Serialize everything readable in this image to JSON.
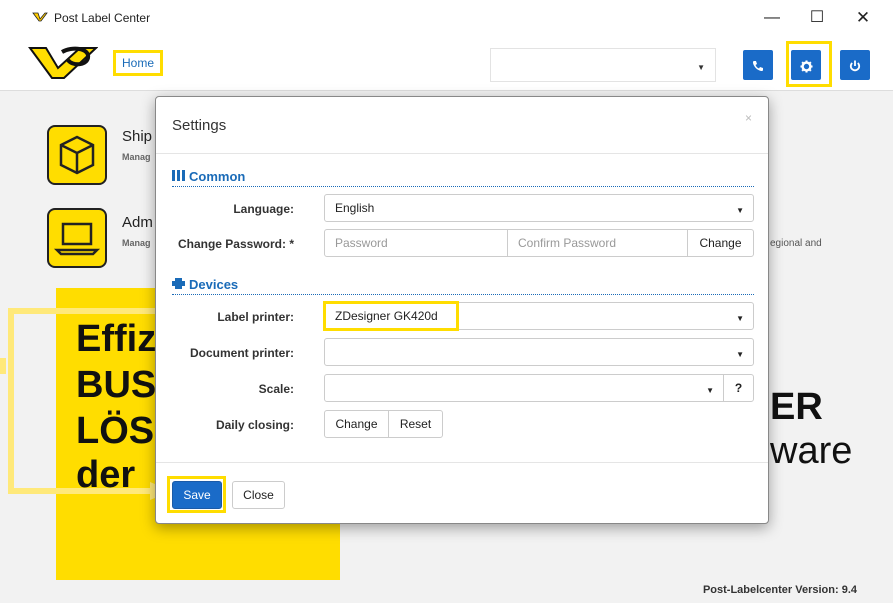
{
  "window": {
    "title": "Post Label Center",
    "minimize": "—",
    "maximize": "☐",
    "close": "✕"
  },
  "header": {
    "home_link": "Home",
    "header_select_value": "",
    "caret": "▼",
    "phone_icon": "phone-icon",
    "gear_icon": "gear-icon",
    "power_icon": "power-icon"
  },
  "background": {
    "tile1_title": "Ship",
    "tile1_sub": "Manag",
    "tile2_title": "Adm",
    "tile2_sub": "Manag",
    "regional_text": "egional and",
    "banner_lines": [
      "Effiz",
      "BUS",
      "LÖS",
      "der"
    ],
    "right_line1": "ER",
    "right_line2": "ware",
    "version": "Post-Labelcenter Version: 9.4"
  },
  "modal": {
    "title": "Settings",
    "close": "×",
    "common": {
      "title": "Common",
      "language_label": "Language:",
      "language_value": "English",
      "password_label": "Change Password: *",
      "password_placeholder": "Password",
      "confirm_placeholder": "Confirm Password",
      "change_button": "Change"
    },
    "devices": {
      "title": "Devices",
      "label_printer_label": "Label printer:",
      "label_printer_value": "ZDesigner GK420d",
      "document_printer_label": "Document printer:",
      "document_printer_value": "",
      "scale_label": "Scale:",
      "scale_value": "",
      "scale_help": "?",
      "daily_closing_label": "Daily closing:",
      "daily_change_button": "Change",
      "daily_reset_button": "Reset"
    },
    "footer": {
      "save_button": "Save",
      "close_button": "Close"
    }
  },
  "colors": {
    "accent_yellow": "#ffdd00",
    "primary_blue": "#1a6bc8",
    "link_blue": "#1a6bb8"
  }
}
